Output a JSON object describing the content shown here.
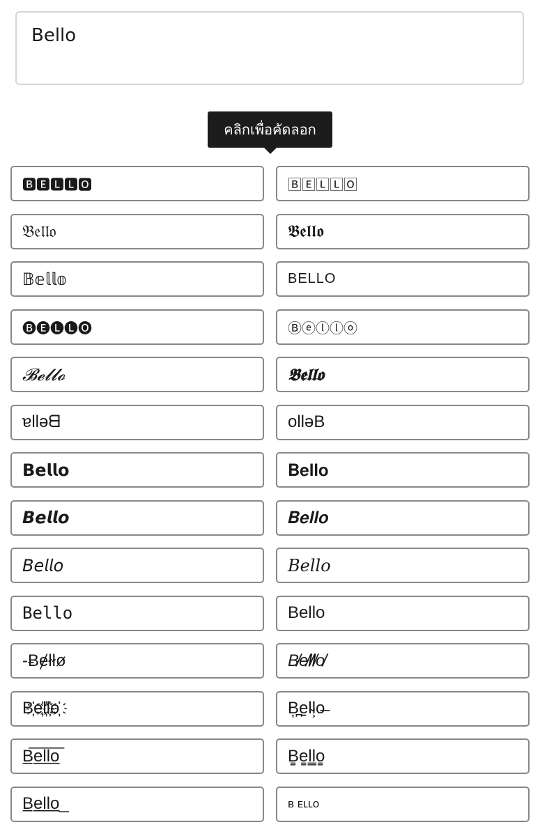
{
  "input": {
    "value": "Bello"
  },
  "tooltip": {
    "text": "คลิกเพื่อคัดลอก"
  },
  "results": [
    {
      "text": "🅱🅴🅻🅻🅾",
      "style": "sans small"
    },
    {
      "text": "🄱🄴🄻🄻🄾",
      "style": "sans small"
    },
    {
      "text": "𝔅𝔢𝔩𝔩𝔬",
      "style": "serif"
    },
    {
      "text": "𝕭𝖊𝖑𝖑𝖔",
      "style": "serif"
    },
    {
      "text": "𝔹𝕖𝕝𝕝𝕠",
      "style": "sans"
    },
    {
      "text": "BELLO",
      "style": "lsans small wide"
    },
    {
      "text": "🅑🅔🅛🅛🅞",
      "style": "sans small"
    },
    {
      "text": "Ⓑⓔⓛⓛⓞ",
      "style": "sans small"
    },
    {
      "text": "𝓑𝓮𝓵𝓵𝓸",
      "style": "serif italic"
    },
    {
      "text": "𝕭𝖊𝖑𝖑𝖔",
      "style": "serif bold italic"
    },
    {
      "text": "ɐllǝᗺ",
      "style": "lsans"
    },
    {
      "text": "ollǝB",
      "style": "lsans"
    },
    {
      "text": "𝗕𝗲𝗹𝗹𝗼",
      "style": "sans"
    },
    {
      "text": "𝐁𝐞𝐥𝐥𝐨",
      "style": "serif"
    },
    {
      "text": "𝘽𝙚𝙡𝙡𝙤",
      "style": "sans"
    },
    {
      "text": "𝑩𝒆𝒍𝒍𝒐",
      "style": "serif"
    },
    {
      "text": "𝘉𝘦𝘭𝘭𝘰",
      "style": "sans"
    },
    {
      "text": "𝐵𝑒𝑙𝑙𝑜",
      "style": "serif"
    },
    {
      "text": "𝙱𝚎𝚕𝚕𝚘",
      "style": "mono"
    },
    {
      "text": "Bello",
      "style": "lsans"
    },
    {
      "text": "-Ƀɇłłø",
      "style": "lsans"
    },
    {
      "text": "B̸e̸l̸l̸o̸",
      "style": "lsans italic"
    },
    {
      "text": "B҉e҉l҉l҉o҉",
      "style": "lsans"
    },
    {
      "text": "B͎̪e̠l̴l͕o̶",
      "style": "lsans"
    },
    {
      "text": "B̲̅e̲̅l̲̅l̲̅o̲̅",
      "style": "lsans"
    },
    {
      "text": "B̳e̳l̳l̳o̳",
      "style": "lsans"
    },
    {
      "text": "B̲e̲l̲l̲o̲_",
      "style": "lsans"
    },
    {
      "text": "ʙ ᴇʟʟᴏ",
      "style": "lsans tiny"
    }
  ]
}
